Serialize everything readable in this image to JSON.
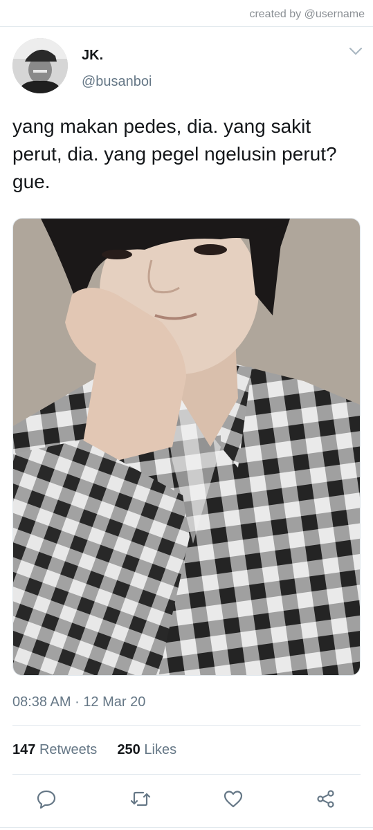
{
  "watermark": "created by @username",
  "tweet": {
    "display_name": "JK.",
    "handle": "@busanboi",
    "text": "yang makan pedes, dia. yang sakit perut, dia. yang pegel ngelusin perut? gue.",
    "time": "08:38 AM",
    "separator": "·",
    "date": "12 Mar 20",
    "retweets_count": "147",
    "retweets_label": "Retweets",
    "likes_count": "250",
    "likes_label": "Likes"
  },
  "icons": {
    "menu": "chevron-down-icon",
    "reply": "reply-icon",
    "retweet": "retweet-icon",
    "like": "heart-icon",
    "share": "share-icon"
  },
  "colors": {
    "text_primary": "#14171a",
    "text_secondary": "#657786",
    "divider": "#e1e8ed"
  }
}
